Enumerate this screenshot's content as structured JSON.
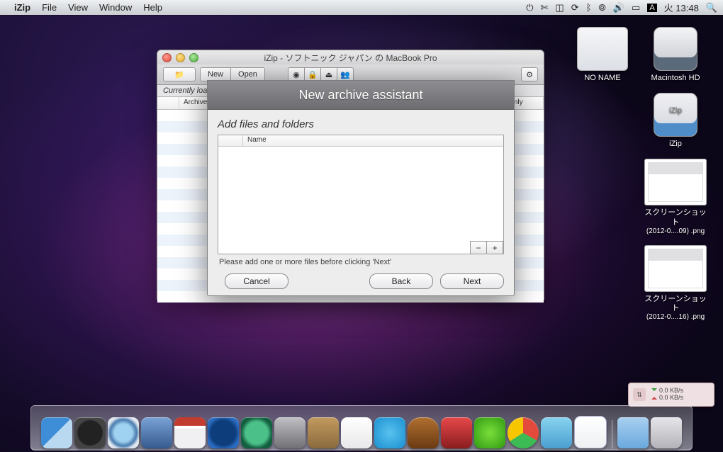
{
  "menubar": {
    "app": "iZip",
    "items": [
      "File",
      "View",
      "Window",
      "Help"
    ],
    "clock": "火 13:48"
  },
  "desktop": {
    "icons": [
      {
        "name": "no-name-drive",
        "label": "NO NAME"
      },
      {
        "name": "macintosh-hd",
        "label": "Macintosh HD"
      },
      {
        "name": "izip-volume",
        "label": "iZip"
      },
      {
        "name": "screenshot-1",
        "label": "スクリーンショット",
        "label2": "(2012-0....09) .png"
      },
      {
        "name": "screenshot-2",
        "label": "スクリーンショット",
        "label2": "(2012-0....16) .png"
      }
    ],
    "network": {
      "down": "0.0 KB/s",
      "up": "0.0 KB/s"
    }
  },
  "window": {
    "title": "iZip - ソフトニック ジャパン の MacBook Pro",
    "toolbar": {
      "new": "New",
      "open": "Open"
    },
    "section": "Currently loa",
    "columns": {
      "archive": "Archive",
      "readonly": "Read-only"
    }
  },
  "sheet": {
    "title": "New archive assistant",
    "subhead": "Add files and folders",
    "column": "Name",
    "plus": "+",
    "minus": "−",
    "hint": "Please add one or more files before clicking 'Next'",
    "buttons": {
      "cancel": "Cancel",
      "back": "Back",
      "next": "Next"
    }
  },
  "dock": {
    "items": [
      "finder",
      "dashboard",
      "safari",
      "mail",
      "ical",
      "itunes",
      "time-machine",
      "system-preferences",
      "box",
      "text-doc",
      "skype",
      "radio",
      "photo-booth",
      "green-app",
      "chrome",
      "butterfly",
      "paper-doc"
    ],
    "tray": [
      "downloads-folder",
      "trash"
    ]
  }
}
